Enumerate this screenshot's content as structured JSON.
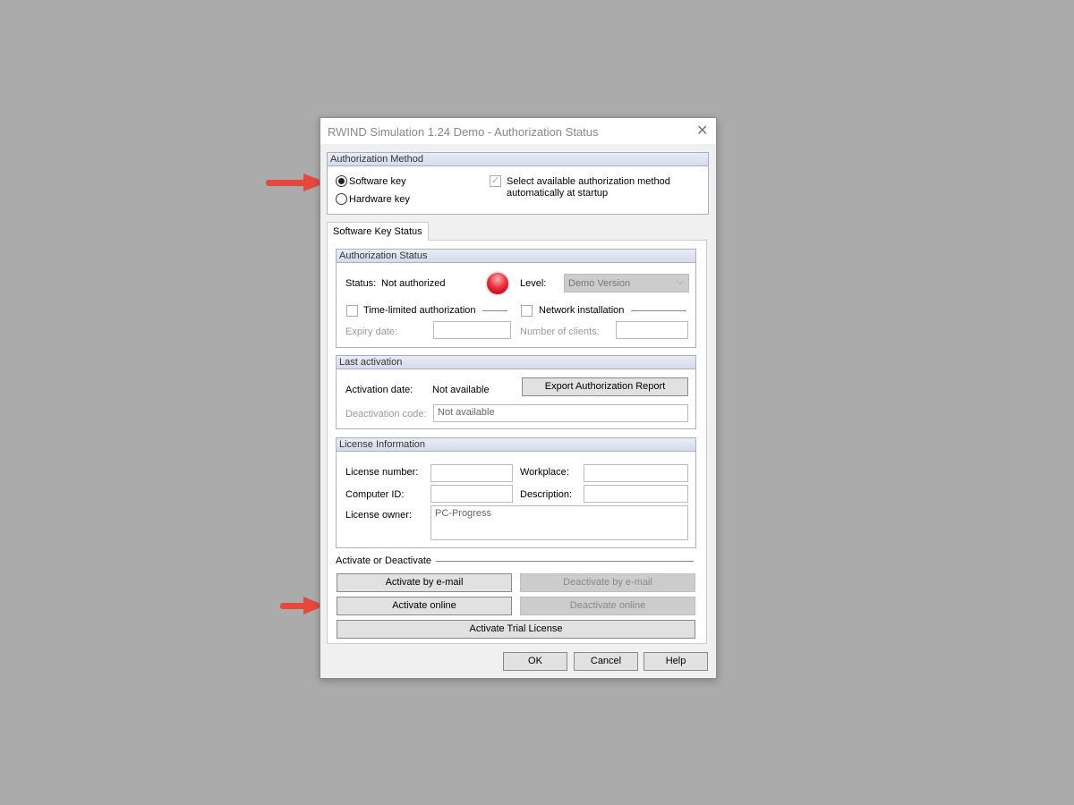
{
  "window": {
    "title": "RWIND Simulation 1.24 Demo - Authorization Status",
    "close": "✕"
  },
  "auth_method": {
    "header": "Authorization Method",
    "software_key": "Software key",
    "hardware_key": "Hardware key",
    "selected": "Software key",
    "auto_select_line1": "Select available authorization method",
    "auto_select_line2": "automatically at startup",
    "auto_select_checked": true
  },
  "tab": {
    "label": "Software Key Status"
  },
  "auth_status": {
    "header": "Authorization Status",
    "status_label": "Status:",
    "status_value": "Not authorized",
    "status_color": "#e0202a",
    "level_label": "Level:",
    "level_value": "Demo Version",
    "time_limited": "Time-limited authorization",
    "network": "Network installation",
    "expiry_label": "Expiry date:",
    "clients_label": "Number of clients:"
  },
  "last_activation": {
    "header": "Last activation",
    "activation_label": "Activation date:",
    "activation_value": "Not available",
    "export_button": "Export Authorization Report",
    "deactivation_label": "Deactivation code:",
    "deactivation_value": "Not available"
  },
  "license": {
    "header": "License Information",
    "license_number": "License number:",
    "workplace": "Workplace:",
    "computer_id": "Computer ID:",
    "description": "Description:",
    "owner_label": "License owner:",
    "owner_value": "PC-Progress"
  },
  "activate": {
    "label": "Activate or Deactivate",
    "by_email": "Activate by e-mail",
    "deactivate_email": "Deactivate by e-mail",
    "online": "Activate online",
    "deactivate_online": "Deactivate online",
    "trial": "Activate Trial License"
  },
  "footer": {
    "ok": "OK",
    "cancel": "Cancel",
    "help": "Help"
  },
  "annotation_color": "#e8473c"
}
